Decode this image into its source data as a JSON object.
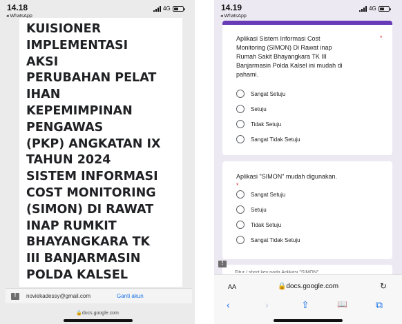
{
  "left": {
    "status": {
      "time": "14.18",
      "back_app": "◂ WhatsApp",
      "network": "4G"
    },
    "title_lines": [
      "KUISIONER",
      "IMPLEMENTASI",
      "AKSI",
      "PERUBAHAN PELAT",
      "IHAN",
      "KEPEMIMPINAN",
      "PENGAWAS",
      "(PKP) ANGKATAN IX",
      "TAHUN 2024",
      "SISTEM INFORMASI",
      "COST MONITORING",
      "(SIMON) DI RAWAT",
      "INAP RUMKIT",
      "BHAYANGKARA TK",
      "III BANJARMASIN",
      "POLDA KALSEL"
    ],
    "account": {
      "email": "noviekadessy@gmail.com",
      "switch_label": "Ganti akun"
    },
    "url": "🔒docs.google.com"
  },
  "right": {
    "status": {
      "time": "14.19",
      "back_app": "◂ WhatsApp",
      "network": "4G"
    },
    "q1": {
      "lines": [
        "Aplikasi Sistem Informasi Cost",
        "Monitoring (SIMON) Di  Rawat inap",
        "Rumah Sakit Bhayangkara TK III",
        "Banjarmasin Polda Kalsel ini mudah di",
        "pahami."
      ],
      "required_mark": "*",
      "options": [
        "Sangat Setuju",
        "Setuju",
        "Tidak Setuju",
        "Sangat Tidak Setuju"
      ]
    },
    "q2": {
      "text": "Aplikasi  \"SIMON\"  mudah digunakan.",
      "required_mark": "*",
      "options": [
        "Sangat Setuju",
        "Setuju",
        "Tidak Setuju",
        "Sangat Tidak Setuju"
      ]
    },
    "q3_cut": "Fitur / short key pada Aplikasi \"SIMON\"",
    "browser": {
      "aa_label": "AA",
      "url": "🔒docs.google.com",
      "reload_icon": "↻"
    },
    "toolbar_icons": [
      "back-icon",
      "forward-icon",
      "share-icon",
      "bookmarks-icon",
      "tabs-icon"
    ],
    "toolbar_glyphs": {
      "back": "‹",
      "forward": "›",
      "share": "⇪",
      "bookmarks": "📖",
      "tabs": "⧉"
    }
  },
  "colors": {
    "form_accent": "#673ab7",
    "required": "#d93025",
    "link": "#1a73e8"
  }
}
